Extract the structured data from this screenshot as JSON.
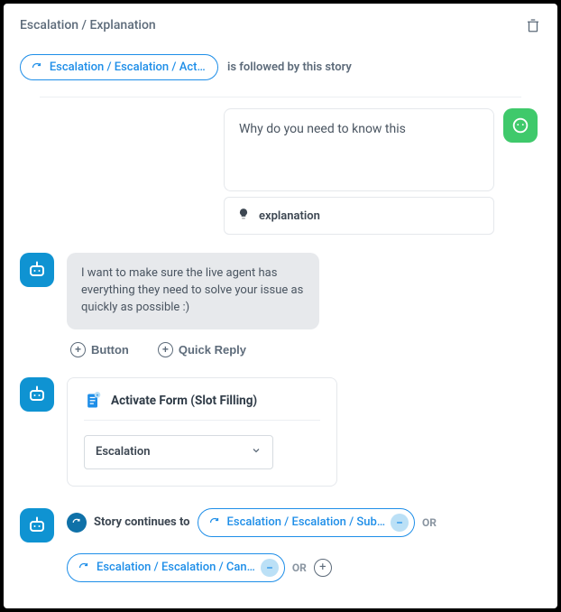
{
  "header": {
    "title": "Escalation / Explanation"
  },
  "followed": {
    "pill_label": "Escalation / Escalation / Acti…",
    "suffix_text": "is followed by this story"
  },
  "user": {
    "message": "Why do you need to know this",
    "intent_label": "explanation"
  },
  "bot_response": {
    "text": "I want to make sure the live agent has everything they need to solve your issue as quickly as possible :)"
  },
  "actions": {
    "button_label": "Button",
    "quick_reply_label": "Quick Reply"
  },
  "form": {
    "title": "Activate Form (Slot Filling)",
    "selected": "Escalation"
  },
  "continues": {
    "label": "Story continues to",
    "items": [
      "Escalation / Escalation / Sub…",
      "Escalation / Escalation / Can…"
    ],
    "or_label": "OR"
  }
}
